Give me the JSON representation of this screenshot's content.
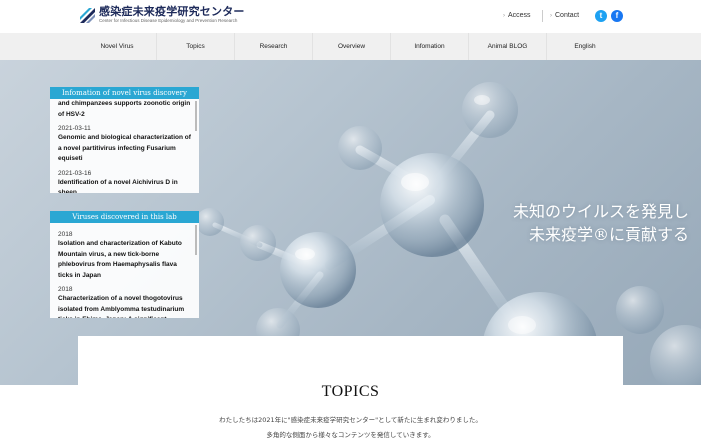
{
  "header": {
    "logo_title": "感染症未来疫学研究センター",
    "logo_subtitle": "Center for Infectious Disease Epidemiology and Prevention Research",
    "links": [
      {
        "label": "Access"
      },
      {
        "label": "Contact"
      }
    ],
    "social": [
      {
        "icon": "twitter-icon",
        "glyph": "t",
        "color": "#1da1f2"
      },
      {
        "icon": "facebook-icon",
        "glyph": "f",
        "color": "#1877f2"
      }
    ]
  },
  "nav": {
    "items": [
      {
        "label": "Novel Virus"
      },
      {
        "label": "Topics"
      },
      {
        "label": "Research"
      },
      {
        "label": "Overview"
      },
      {
        "label": "Infomation"
      },
      {
        "label": "Animal BLOG"
      },
      {
        "label": "English"
      }
    ]
  },
  "hero": {
    "catch_line1": "未知のウイルスを発見し",
    "catch_line2": "未来疫学®に貢献する"
  },
  "panels": {
    "novel": {
      "title": "Infomation of novel virus discovery",
      "entries": [
        {
          "date": "",
          "title": "and chimpanzees supports zoonotic origin of HSV-2"
        },
        {
          "date": "2021-03-11",
          "title": "Genomic and biological characterization of a novel partitivirus infecting Fusarium equiseti"
        },
        {
          "date": "2021-03-16",
          "title": "Identification of a novel Aichivirus D in sheep"
        }
      ]
    },
    "discovered": {
      "title": "Viruses discovered in this lab",
      "entries": [
        {
          "date": "2018",
          "title": "Isolation and characterization of Kabuto Mountain virus, a new tick-borne phlebovirus from Haemaphysalis flava ticks in Japan"
        },
        {
          "date": "2018",
          "title": "Characterization of a novel thogotovirus isolated from Amblyomma testudinarium ticks in Ehime, Japan: A significant"
        }
      ]
    }
  },
  "topics": {
    "heading": "TOPICS",
    "line1": "わたしたちは2021年に\"感染症未来疫学研究センター\"として新たに生まれ変わりました。",
    "line2": "多角的な側面から様々なコンテンツを発信していきます。"
  },
  "colors": {
    "accent": "#2aa7d3",
    "nav_bg": "#f0f0f0",
    "logo_navy": "#1d2a5a"
  }
}
